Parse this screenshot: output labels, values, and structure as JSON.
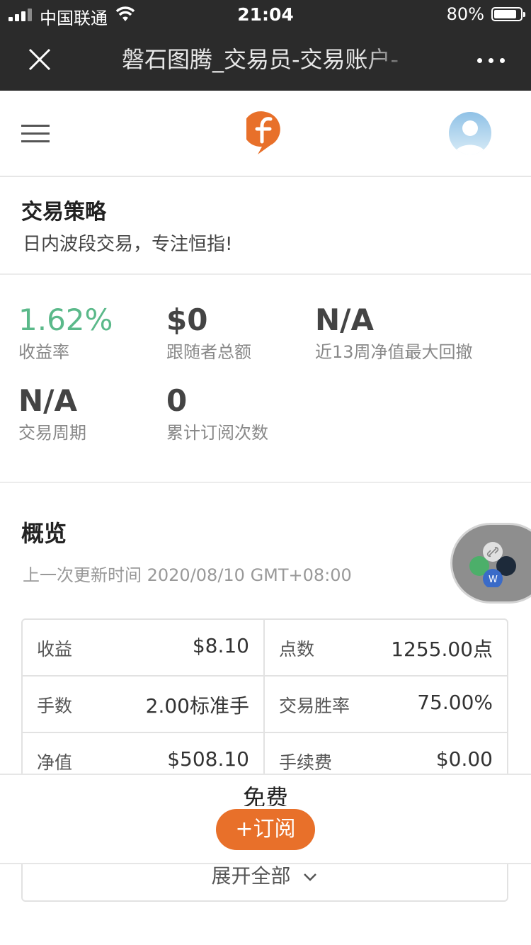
{
  "status_bar": {
    "carrier": "中国联通",
    "time": "21:04",
    "battery": "80%",
    "battery_level": 0.8
  },
  "title_bar": {
    "title": "磐石图腾_交易员-交易账户-",
    "close_icon": "close-icon",
    "more_icon": "more-icon"
  },
  "header": {
    "menu_icon": "hamburger-icon",
    "logo_icon": "brand-logo",
    "avatar_icon": "user-avatar",
    "brand_color": "#e8702a"
  },
  "strategy": {
    "title": "交易策略",
    "description": "日内波段交易，专注恒指!"
  },
  "stats": [
    {
      "value": "1.62%",
      "label": "收益率"
    },
    {
      "value": "$0",
      "label": "跟随者总额"
    },
    {
      "value": "N/A",
      "label": "近13周净值最大回撤"
    },
    {
      "value": "N/A",
      "label": "交易周期"
    },
    {
      "value": "0",
      "label": "累计订阅次数"
    }
  ],
  "overview": {
    "title": "概览",
    "updated": "上一次更新时间 2020/08/10 GMT+08:00",
    "rows": [
      [
        {
          "key": "收益",
          "value": "$8.10"
        },
        {
          "key": "点数",
          "value": "1255.00点"
        }
      ],
      [
        {
          "key": "手数",
          "value": "2.00标准手"
        },
        {
          "key": "交易胜率",
          "value": "75.00%"
        }
      ],
      [
        {
          "key": "净值",
          "value": "$508.10"
        },
        {
          "key": "手续费",
          "value": "$0.00"
        }
      ]
    ],
    "expand_label": "展开全部"
  },
  "bottom_bar": {
    "price": "免费",
    "subscribe_label": "+订阅"
  },
  "colors": {
    "green": "#5bb98a",
    "orange": "#e8702a",
    "dark_bar": "#2b2b2b"
  }
}
